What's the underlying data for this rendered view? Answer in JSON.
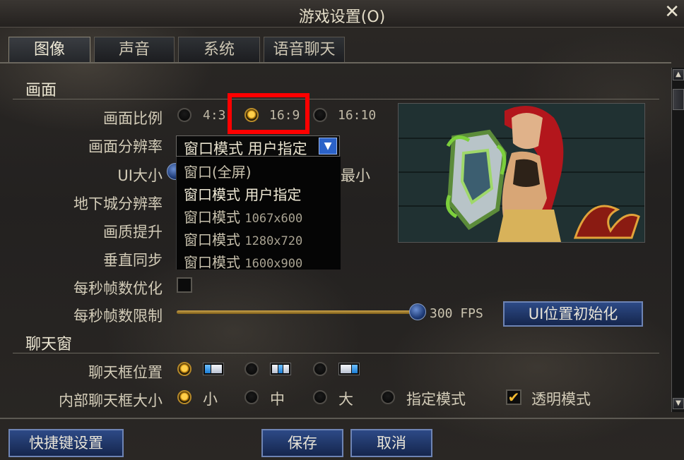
{
  "window": {
    "title": "游戏设置(O)",
    "close_label": "✕"
  },
  "tabs": [
    {
      "label": "图像",
      "active": true
    },
    {
      "label": "声音",
      "active": false
    },
    {
      "label": "系统",
      "active": false
    },
    {
      "label": "语音聊天",
      "active": false
    }
  ],
  "screen_section": {
    "title": "画面",
    "aspect_ratio": {
      "label": "画面比例",
      "options": [
        "4:3",
        "16:9",
        "16:10"
      ],
      "selected": "16:9"
    },
    "resolution": {
      "label": "画面分辨率",
      "selected": "窗口模式 用户指定",
      "dropdown_options": [
        {
          "main": "窗口(全屏)",
          "sub": ""
        },
        {
          "main": "窗口模式 用户指定",
          "sub": ""
        },
        {
          "main": "窗口模式",
          "sub": "1067x600"
        },
        {
          "main": "窗口模式",
          "sub": "1280x720"
        },
        {
          "main": "窗口模式",
          "sub": "1600x900"
        }
      ]
    },
    "ui_size": {
      "label": "UI大小",
      "right_text": "最小"
    },
    "dungeon_resolution": {
      "label": "地下城分辨率"
    },
    "quality_boost": {
      "label": "画质提升"
    },
    "vsync": {
      "label": "垂直同步"
    },
    "fps_optimize": {
      "label": "每秒帧数优化",
      "checked": false
    },
    "fps_limit": {
      "label": "每秒帧数限制",
      "value_text": "300 FPS",
      "fraction": 1.0
    },
    "ui_reset_button": "UI位置初始化"
  },
  "chat_section": {
    "title": "聊天窗",
    "position": {
      "label": "聊天框位置",
      "selected_index": 0
    },
    "inner_size": {
      "label": "内部聊天框大小",
      "options": [
        "小",
        "中",
        "大",
        "指定模式"
      ],
      "selected": "小"
    },
    "transparent": {
      "label": "透明模式",
      "checked": true
    }
  },
  "footer": {
    "shortcut_button": "快捷键设置",
    "save_button": "保存",
    "cancel_button": "取消"
  }
}
